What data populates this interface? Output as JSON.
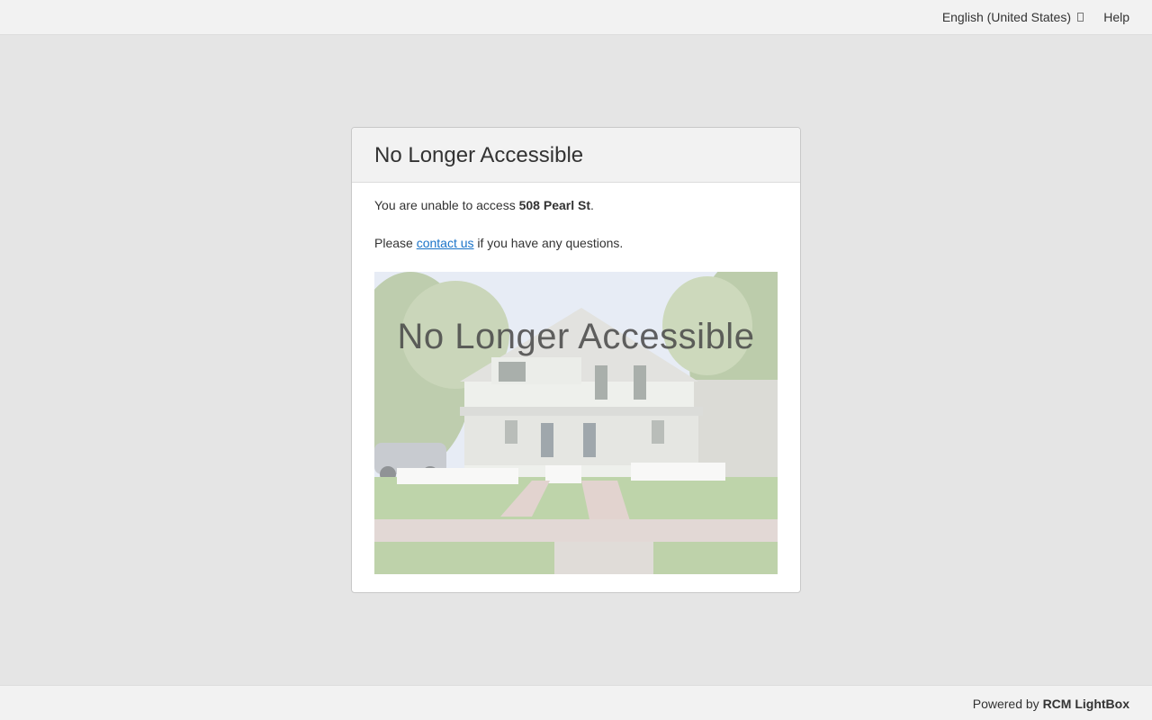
{
  "header": {
    "language_label": "English (United States)",
    "help_label": "Help"
  },
  "card": {
    "title": "No Longer Accessible",
    "message_prefix": "You are unable to access ",
    "property_name": "508 Pearl St",
    "message_suffix": ".",
    "contact_prefix": "Please ",
    "contact_link": "contact us",
    "contact_suffix": " if you have any questions.",
    "photo_overlay_text": "No Longer Accessible"
  },
  "footer": {
    "powered_prefix": "Powered by ",
    "brand": "RCM LightBox"
  },
  "colors": {
    "page_bg": "#e5e5e5",
    "bar_bg": "#f2f2f2",
    "link": "#1a73c8"
  },
  "icons": {
    "language_dropdown": "caret-icon"
  }
}
